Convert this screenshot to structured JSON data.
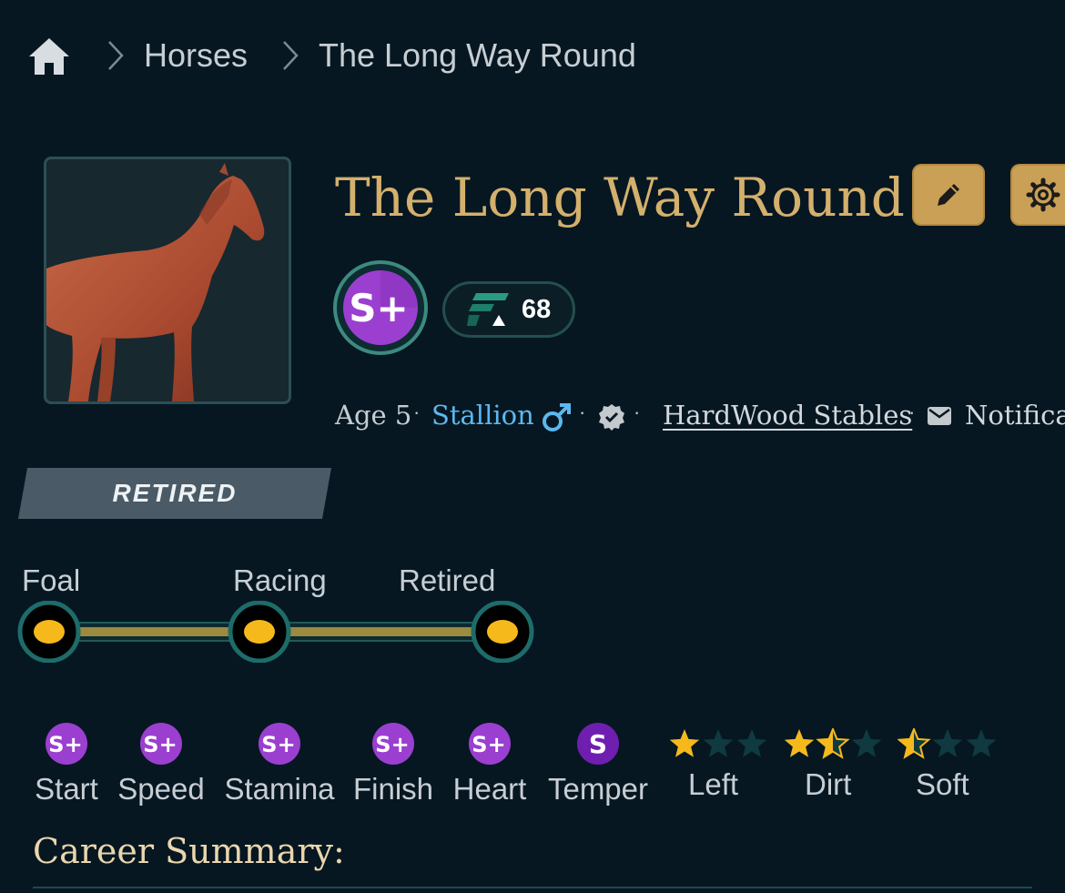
{
  "breadcrumb": {
    "items": [
      "Horses",
      "The Long Way Round"
    ]
  },
  "horse": {
    "name": "The Long Way Round",
    "grade": "S+",
    "rating": "68",
    "age": "Age 5",
    "sex": "Stallion",
    "stable": "HardWood Stables",
    "notifications": "Notifica",
    "status": "RETIRED"
  },
  "lifecycle": {
    "stages": [
      "Foal",
      "Racing",
      "Retired"
    ]
  },
  "traits": [
    {
      "grade": "S+",
      "label": "Start"
    },
    {
      "grade": "S+",
      "label": "Speed"
    },
    {
      "grade": "S+",
      "label": "Stamina"
    },
    {
      "grade": "S+",
      "label": "Finish"
    },
    {
      "grade": "S+",
      "label": "Heart"
    },
    {
      "grade": "S",
      "label": "Temper"
    }
  ],
  "preferences": [
    {
      "label": "Left",
      "stars": 1
    },
    {
      "label": "Dirt",
      "stars": 1.5
    },
    {
      "label": "Soft",
      "stars": 0.5
    }
  ],
  "career": {
    "title": "Career Summary:"
  },
  "colors": {
    "background": "#061722",
    "gold": "#d4b06d",
    "accent_blue": "#5db8ef",
    "grade_purple": "#9b3fd0",
    "star_yellow": "#f6b91c"
  }
}
